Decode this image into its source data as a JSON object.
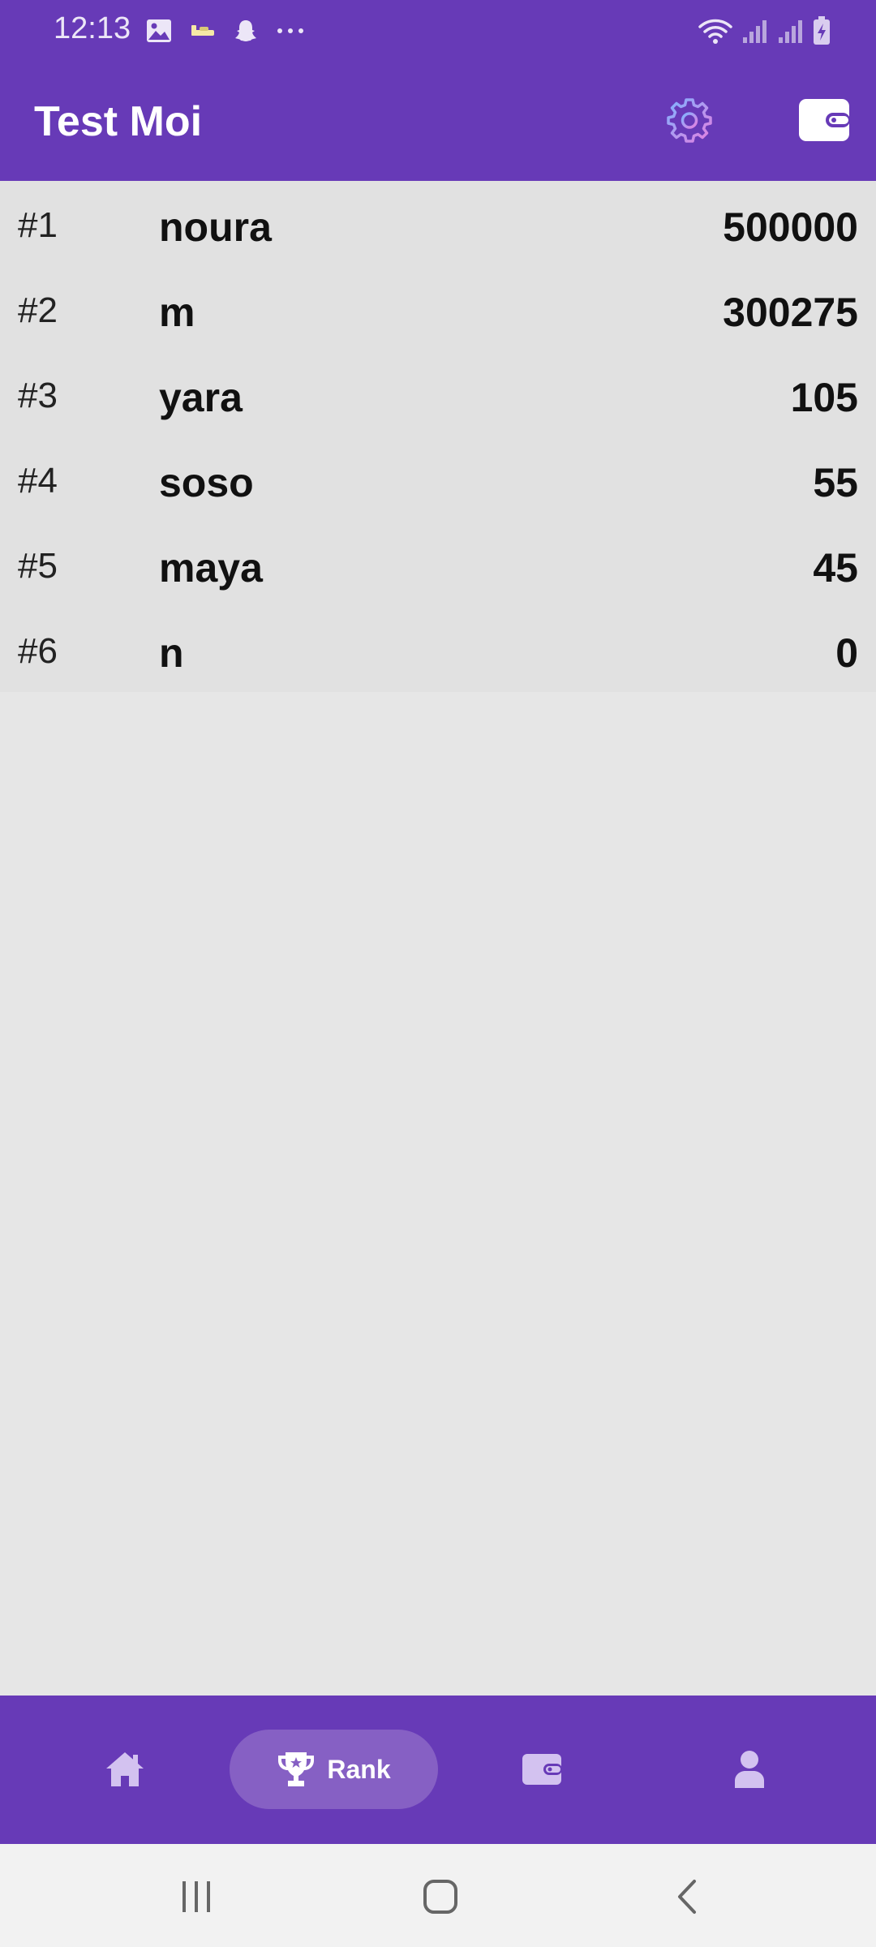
{
  "status_bar": {
    "time": "12:13",
    "left_icons": [
      "image-icon",
      "sleep-icon",
      "snapchat-icon",
      "more-dots-icon"
    ],
    "right_icons": [
      "wifi-icon",
      "signal-icon",
      "signal-icon",
      "battery-charging-icon"
    ]
  },
  "app_bar": {
    "title": "Test Moi",
    "actions": [
      "gear-icon",
      "wallet-icon"
    ]
  },
  "ranking": [
    {
      "position": "#1",
      "name": "noura",
      "score": "500000"
    },
    {
      "position": "#2",
      "name": "m",
      "score": "300275"
    },
    {
      "position": "#3",
      "name": "yara",
      "score": "105"
    },
    {
      "position": "#4",
      "name": "soso",
      "score": "55"
    },
    {
      "position": "#5",
      "name": "maya",
      "score": "45"
    },
    {
      "position": "#6",
      "name": "n",
      "score": "0"
    }
  ],
  "bottom_nav": {
    "items": [
      {
        "icon": "home-icon",
        "label": ""
      },
      {
        "icon": "trophy-icon",
        "label": "Rank",
        "selected": true
      },
      {
        "icon": "wallet-icon",
        "label": ""
      },
      {
        "icon": "profile-icon",
        "label": ""
      }
    ]
  },
  "colors": {
    "primary": "#673ab7",
    "nav_selected": "#8660c4",
    "list_background": "#e1e1e1",
    "page_background": "#e6e6e6"
  }
}
